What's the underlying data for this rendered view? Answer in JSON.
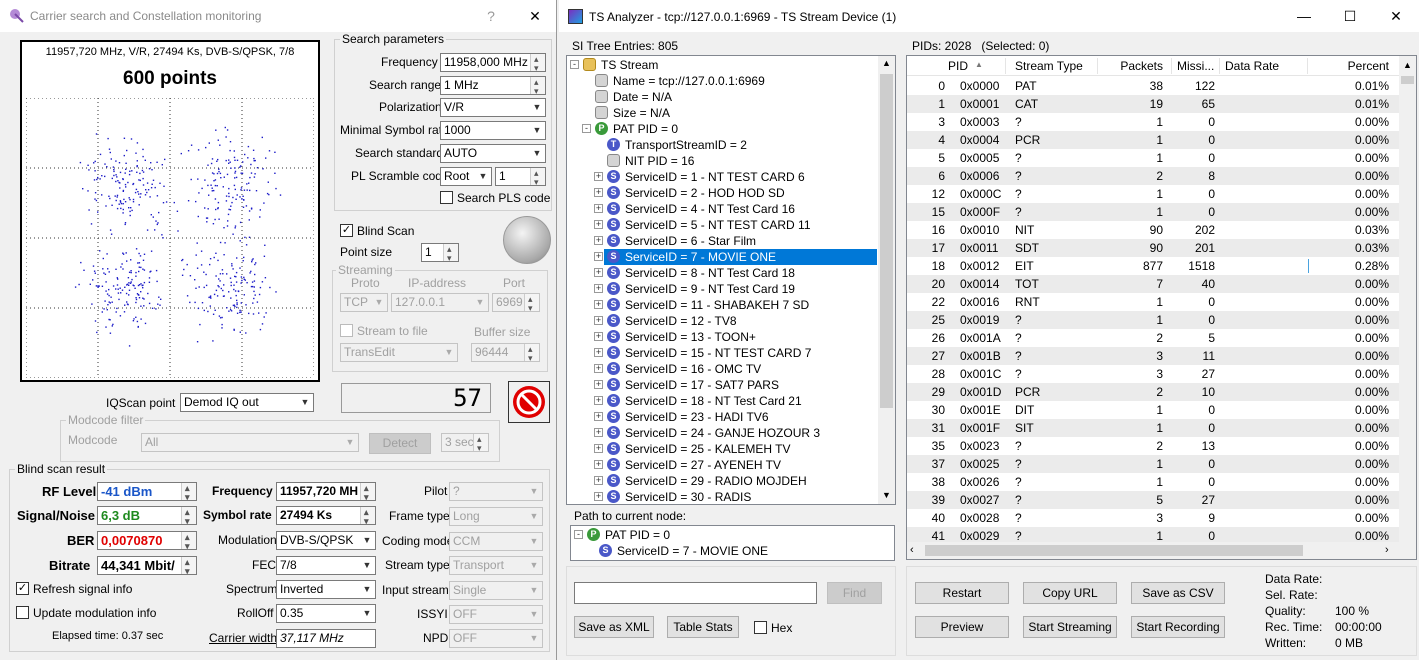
{
  "left": {
    "title": "Carrier search and Constellation monitoring",
    "help": "?",
    "close": "✕",
    "const_info": "11957,720 MHz, V/R, 27494 Ks, DVB-S/QPSK, 7/8",
    "const_points": "600 points",
    "search": {
      "group": "Search parameters",
      "frequency_label": "Frequency",
      "frequency": "11958,000 MHz",
      "range_label": "Search range",
      "range": "1 MHz",
      "pol_label": "Polarization",
      "pol": "V/R",
      "msr_label": "Minimal Symbol rate",
      "msr": "1000",
      "std_label": "Search standard",
      "std": "AUTO",
      "pls_label": "PL Scramble code",
      "pls_mode": "Root",
      "pls_val": "1",
      "plscode_label": "Search PLS code"
    },
    "blind_scan_label": "Blind Scan",
    "point_size_label": "Point size",
    "point_size": "1",
    "stream": {
      "group": "Streaming",
      "proto_label": "Proto",
      "ip_label": "IP-address",
      "port_label": "Port",
      "proto": "TCP",
      "ip": "127.0.0.1",
      "port": "6969",
      "to_file_label": "Stream to file",
      "buf_label": "Buffer size",
      "file": "TransEdit",
      "buf": "96444"
    },
    "counter": "57",
    "iq_label": "IQScan point",
    "iq": "Demod IQ out",
    "modcode": {
      "group": "Modcode filter",
      "label": "Modcode",
      "value": "All",
      "detect": "Detect",
      "sec": "3 sec"
    },
    "result": {
      "group": "Blind scan result",
      "rf_label": "RF Level",
      "rf": "-41 dBm",
      "sn_label": "Signal/Noise",
      "sn": "6,3 dB",
      "ber_label": "BER",
      "ber": "0,0070870",
      "br_label": "Bitrate",
      "br": "44,341 Mbit/",
      "freq_label": "Frequency",
      "freq": "11957,720 MH",
      "sr_label": "Symbol rate",
      "sr": "27494 Ks",
      "mod_label": "Modulation",
      "mod": "DVB-S/QPSK",
      "fec_label": "FEC",
      "fec": "7/8",
      "spec_label": "Spectrum",
      "spec": "Inverted",
      "roll_label": "RollOff",
      "roll": "0.35",
      "cw_label": "Carrier width",
      "cw": "37,117 MHz",
      "pilot_label": "Pilot",
      "pilot": "?",
      "frame_label": "Frame type",
      "frame": "Long",
      "coding_label": "Coding mode",
      "coding": "CCM",
      "stype_label": "Stream type",
      "stype": "Transport",
      "istream_label": "Input stream",
      "istream": "Single",
      "issyi_label": "ISSYI",
      "issyi": "OFF",
      "npd_label": "NPD",
      "npd": "OFF",
      "refresh_label": "Refresh signal info",
      "update_label": "Update modulation info",
      "elapsed": "Elapsed time: 0.37 sec"
    }
  },
  "right": {
    "title": "TS Analyzer - tcp://127.0.0.1:6969 - TS Stream Device (1)",
    "min": "—",
    "max": "☐",
    "close": "✕",
    "si_entries": "SI Tree Entries: 805",
    "pids_info": "PIDs: 2028   (Selected: 0)",
    "tree": [
      {
        "t": "TS Stream",
        "lvl": 0,
        "ic": "folder",
        "ex": "-"
      },
      {
        "t": "Name = tcp://127.0.0.1:6969",
        "lvl": 1,
        "ic": "gray"
      },
      {
        "t": "Date = N/A",
        "lvl": 1,
        "ic": "gray"
      },
      {
        "t": "Size = N/A",
        "lvl": 1,
        "ic": "gray"
      },
      {
        "t": "PAT PID = 0",
        "lvl": 1,
        "ic": "P",
        "ex": "-"
      },
      {
        "t": "TransportStreamID = 2",
        "lvl": 2,
        "ic": "T"
      },
      {
        "t": "NIT PID = 16",
        "lvl": 2,
        "ic": "gray"
      },
      {
        "t": "ServiceID = 1 - NT TEST CARD 6",
        "lvl": 2,
        "ic": "S",
        "ex": "+"
      },
      {
        "t": "ServiceID = 2 - HOD HOD SD",
        "lvl": 2,
        "ic": "S",
        "ex": "+"
      },
      {
        "t": "ServiceID = 4 - NT Test Card 16",
        "lvl": 2,
        "ic": "S",
        "ex": "+"
      },
      {
        "t": "ServiceID = 5 - NT TEST CARD 11",
        "lvl": 2,
        "ic": "S",
        "ex": "+"
      },
      {
        "t": "ServiceID = 6 - Star Film",
        "lvl": 2,
        "ic": "S",
        "ex": "+"
      },
      {
        "t": "ServiceID = 7 - MOVIE ONE",
        "lvl": 2,
        "ic": "S",
        "ex": "+",
        "sel": true
      },
      {
        "t": "ServiceID = 8 - NT Test Card 18",
        "lvl": 2,
        "ic": "S",
        "ex": "+"
      },
      {
        "t": "ServiceID = 9 - NT Test Card 19",
        "lvl": 2,
        "ic": "S",
        "ex": "+"
      },
      {
        "t": "ServiceID = 11 - SHABAKEH 7 SD",
        "lvl": 2,
        "ic": "S",
        "ex": "+"
      },
      {
        "t": "ServiceID = 12 - TV8",
        "lvl": 2,
        "ic": "S",
        "ex": "+"
      },
      {
        "t": "ServiceID = 13 - TOON+",
        "lvl": 2,
        "ic": "S",
        "ex": "+"
      },
      {
        "t": "ServiceID = 15 - NT TEST CARD 7",
        "lvl": 2,
        "ic": "S",
        "ex": "+"
      },
      {
        "t": "ServiceID = 16 - OMC TV",
        "lvl": 2,
        "ic": "S",
        "ex": "+"
      },
      {
        "t": "ServiceID = 17 - SAT7 PARS",
        "lvl": 2,
        "ic": "S",
        "ex": "+"
      },
      {
        "t": "ServiceID = 18 - NT Test Card 21",
        "lvl": 2,
        "ic": "S",
        "ex": "+"
      },
      {
        "t": "ServiceID = 23 - HADI TV6",
        "lvl": 2,
        "ic": "S",
        "ex": "+"
      },
      {
        "t": "ServiceID = 24 - GANJE HOZOUR 3",
        "lvl": 2,
        "ic": "S",
        "ex": "+"
      },
      {
        "t": "ServiceID = 25 - KALEMEH TV",
        "lvl": 2,
        "ic": "S",
        "ex": "+"
      },
      {
        "t": "ServiceID = 27 - AYENEH TV",
        "lvl": 2,
        "ic": "S",
        "ex": "+"
      },
      {
        "t": "ServiceID = 29 - RADIO MOJDEH",
        "lvl": 2,
        "ic": "S",
        "ex": "+"
      },
      {
        "t": "ServiceID = 30 - RADIS",
        "lvl": 2,
        "ic": "S",
        "ex": "+"
      }
    ],
    "path_label": "Path to current node:",
    "path": [
      {
        "t": "PAT PID = 0",
        "ic": "P",
        "ex": "-"
      },
      {
        "t": "ServiceID = 7 - MOVIE ONE",
        "ic": "S"
      }
    ],
    "columns": [
      "PID",
      "Stream Type",
      "Packets",
      "Missi...",
      "Data Rate",
      "Percent"
    ],
    "rows": [
      [
        "0",
        "0x0000",
        "PAT",
        "38",
        "122",
        "",
        "0.01%"
      ],
      [
        "1",
        "0x0001",
        "CAT",
        "19",
        "65",
        "",
        "0.01%"
      ],
      [
        "3",
        "0x0003",
        "?",
        "1",
        "0",
        "",
        "0.00%"
      ],
      [
        "4",
        "0x0004",
        "PCR",
        "1",
        "0",
        "",
        "0.00%"
      ],
      [
        "5",
        "0x0005",
        "?",
        "1",
        "0",
        "",
        "0.00%"
      ],
      [
        "6",
        "0x0006",
        "?",
        "2",
        "8",
        "",
        "0.00%"
      ],
      [
        "12",
        "0x000C",
        "?",
        "1",
        "0",
        "",
        "0.00%"
      ],
      [
        "15",
        "0x000F",
        "?",
        "1",
        "0",
        "",
        "0.00%"
      ],
      [
        "16",
        "0x0010",
        "NIT",
        "90",
        "202",
        "",
        "0.03%"
      ],
      [
        "17",
        "0x0011",
        "SDT",
        "90",
        "201",
        "",
        "0.03%"
      ],
      [
        "18",
        "0x0012",
        "EIT",
        "877",
        "1518",
        "",
        "0.28%"
      ],
      [
        "20",
        "0x0014",
        "TOT",
        "7",
        "40",
        "",
        "0.00%"
      ],
      [
        "22",
        "0x0016",
        "RNT",
        "1",
        "0",
        "",
        "0.00%"
      ],
      [
        "25",
        "0x0019",
        "?",
        "1",
        "0",
        "",
        "0.00%"
      ],
      [
        "26",
        "0x001A",
        "?",
        "2",
        "5",
        "",
        "0.00%"
      ],
      [
        "27",
        "0x001B",
        "?",
        "3",
        "11",
        "",
        "0.00%"
      ],
      [
        "28",
        "0x001C",
        "?",
        "3",
        "27",
        "",
        "0.00%"
      ],
      [
        "29",
        "0x001D",
        "PCR",
        "2",
        "10",
        "",
        "0.00%"
      ],
      [
        "30",
        "0x001E",
        "DIT",
        "1",
        "0",
        "",
        "0.00%"
      ],
      [
        "31",
        "0x001F",
        "SIT",
        "1",
        "0",
        "",
        "0.00%"
      ],
      [
        "35",
        "0x0023",
        "?",
        "2",
        "13",
        "",
        "0.00%"
      ],
      [
        "37",
        "0x0025",
        "?",
        "1",
        "0",
        "",
        "0.00%"
      ],
      [
        "38",
        "0x0026",
        "?",
        "1",
        "0",
        "",
        "0.00%"
      ],
      [
        "39",
        "0x0027",
        "?",
        "5",
        "27",
        "",
        "0.00%"
      ],
      [
        "40",
        "0x0028",
        "?",
        "3",
        "9",
        "",
        "0.00%"
      ],
      [
        "41",
        "0x0029",
        "?",
        "1",
        "0",
        "",
        "0.00%"
      ]
    ],
    "find": "Find",
    "save_xml": "Save as XML",
    "table_stats": "Table Stats",
    "hex": "Hex",
    "restart": "Restart",
    "copy_url": "Copy URL",
    "save_csv": "Save as CSV",
    "preview": "Preview",
    "start_streaming": "Start Streaming",
    "start_recording": "Start Recording",
    "stats": [
      {
        "k": "Data Rate:",
        "v": ""
      },
      {
        "k": "Sel. Rate:",
        "v": ""
      },
      {
        "k": "Quality:",
        "v": "100 %"
      },
      {
        "k": "Rec. Time:",
        "v": "00:00:00"
      },
      {
        "k": "Written:",
        "v": "0 MB"
      }
    ]
  },
  "colors": {
    "accent": "#0078d7",
    "rf": "#1a56c8",
    "sn": "#1e8a1e",
    "ber": "#e00000",
    "point": "#1c1cc8"
  }
}
